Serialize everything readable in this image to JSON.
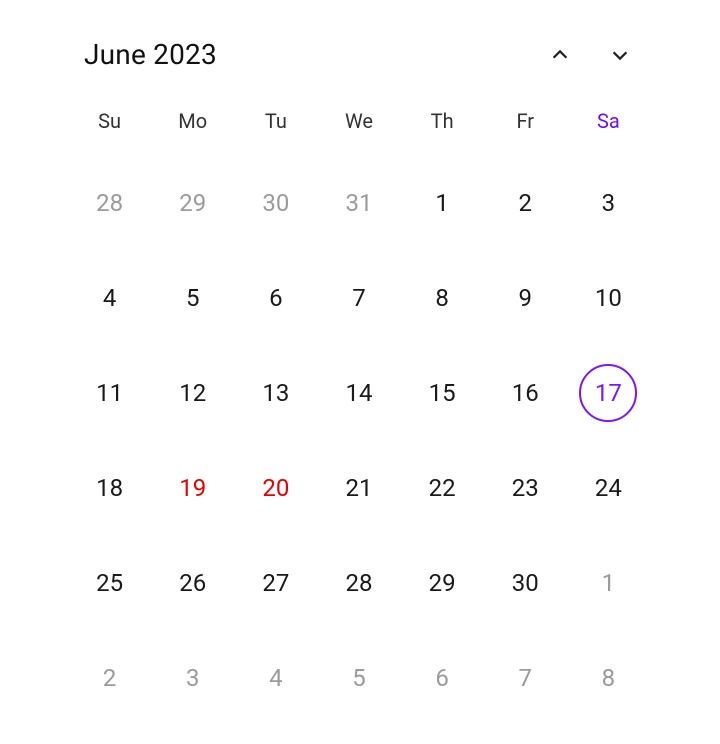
{
  "accentColor": "#7a17ff",
  "header": {
    "title": "June 2023"
  },
  "daysOfWeek": [
    {
      "short": "Su",
      "accent": false
    },
    {
      "short": "Mo",
      "accent": false
    },
    {
      "short": "Tu",
      "accent": false
    },
    {
      "short": "We",
      "accent": false
    },
    {
      "short": "Th",
      "accent": false
    },
    {
      "short": "Fr",
      "accent": false
    },
    {
      "short": "Sa",
      "accent": true
    }
  ],
  "weeks": [
    [
      {
        "day": 28,
        "muted": true,
        "holiday": false,
        "today": false
      },
      {
        "day": 29,
        "muted": true,
        "holiday": false,
        "today": false
      },
      {
        "day": 30,
        "muted": true,
        "holiday": false,
        "today": false
      },
      {
        "day": 31,
        "muted": true,
        "holiday": false,
        "today": false
      },
      {
        "day": 1,
        "muted": false,
        "holiday": false,
        "today": false
      },
      {
        "day": 2,
        "muted": false,
        "holiday": false,
        "today": false
      },
      {
        "day": 3,
        "muted": false,
        "holiday": false,
        "today": false
      }
    ],
    [
      {
        "day": 4,
        "muted": false,
        "holiday": false,
        "today": false
      },
      {
        "day": 5,
        "muted": false,
        "holiday": false,
        "today": false
      },
      {
        "day": 6,
        "muted": false,
        "holiday": false,
        "today": false
      },
      {
        "day": 7,
        "muted": false,
        "holiday": false,
        "today": false
      },
      {
        "day": 8,
        "muted": false,
        "holiday": false,
        "today": false
      },
      {
        "day": 9,
        "muted": false,
        "holiday": false,
        "today": false
      },
      {
        "day": 10,
        "muted": false,
        "holiday": false,
        "today": false
      }
    ],
    [
      {
        "day": 11,
        "muted": false,
        "holiday": false,
        "today": false
      },
      {
        "day": 12,
        "muted": false,
        "holiday": false,
        "today": false
      },
      {
        "day": 13,
        "muted": false,
        "holiday": false,
        "today": false
      },
      {
        "day": 14,
        "muted": false,
        "holiday": false,
        "today": false
      },
      {
        "day": 15,
        "muted": false,
        "holiday": false,
        "today": false
      },
      {
        "day": 16,
        "muted": false,
        "holiday": false,
        "today": false
      },
      {
        "day": 17,
        "muted": false,
        "holiday": false,
        "today": true
      }
    ],
    [
      {
        "day": 18,
        "muted": false,
        "holiday": false,
        "today": false
      },
      {
        "day": 19,
        "muted": false,
        "holiday": true,
        "today": false
      },
      {
        "day": 20,
        "muted": false,
        "holiday": true,
        "today": false
      },
      {
        "day": 21,
        "muted": false,
        "holiday": false,
        "today": false
      },
      {
        "day": 22,
        "muted": false,
        "holiday": false,
        "today": false
      },
      {
        "day": 23,
        "muted": false,
        "holiday": false,
        "today": false
      },
      {
        "day": 24,
        "muted": false,
        "holiday": false,
        "today": false
      }
    ],
    [
      {
        "day": 25,
        "muted": false,
        "holiday": false,
        "today": false
      },
      {
        "day": 26,
        "muted": false,
        "holiday": false,
        "today": false
      },
      {
        "day": 27,
        "muted": false,
        "holiday": false,
        "today": false
      },
      {
        "day": 28,
        "muted": false,
        "holiday": false,
        "today": false
      },
      {
        "day": 29,
        "muted": false,
        "holiday": false,
        "today": false
      },
      {
        "day": 30,
        "muted": false,
        "holiday": false,
        "today": false
      },
      {
        "day": 1,
        "muted": true,
        "holiday": false,
        "today": false
      }
    ],
    [
      {
        "day": 2,
        "muted": true,
        "holiday": false,
        "today": false
      },
      {
        "day": 3,
        "muted": true,
        "holiday": false,
        "today": false
      },
      {
        "day": 4,
        "muted": true,
        "holiday": false,
        "today": false
      },
      {
        "day": 5,
        "muted": true,
        "holiday": false,
        "today": false
      },
      {
        "day": 6,
        "muted": true,
        "holiday": false,
        "today": false
      },
      {
        "day": 7,
        "muted": true,
        "holiday": false,
        "today": false
      },
      {
        "day": 8,
        "muted": true,
        "holiday": false,
        "today": false
      }
    ]
  ]
}
